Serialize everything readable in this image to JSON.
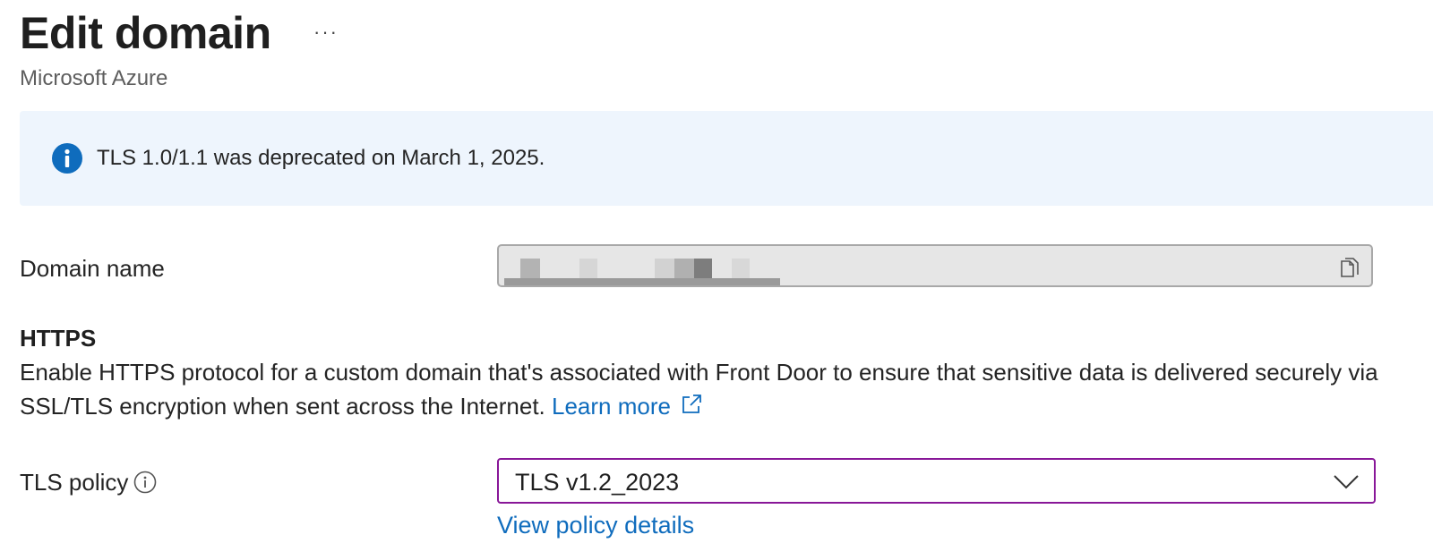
{
  "header": {
    "title": "Edit domain",
    "more_label": "···",
    "subtitle": "Microsoft Azure"
  },
  "banner": {
    "icon": "info-icon",
    "text": "TLS 1.0/1.1 was deprecated on March 1, 2025.",
    "background": "#eef5fd",
    "icon_color": "#0f6cbd"
  },
  "domain": {
    "label": "Domain name",
    "value_redacted": true,
    "copy_icon": "copy-icon"
  },
  "https": {
    "heading": "HTTPS",
    "description": "Enable HTTPS protocol for a custom domain that's associated with Front Door to ensure that sensitive data is delivered securely via SSL/TLS encryption when sent across the Internet.",
    "learn_more": "Learn more",
    "learn_more_icon": "external-link-icon"
  },
  "tls_policy": {
    "label": "TLS policy",
    "info_icon": "info-circle-icon",
    "selected": "TLS v1.2_2023",
    "chevron_icon": "chevron-down-icon",
    "view_details": "View policy details",
    "focus_color": "#881798"
  },
  "colors": {
    "link": "#0f6cbd",
    "text": "#242424",
    "muted": "#5e5e5e"
  }
}
